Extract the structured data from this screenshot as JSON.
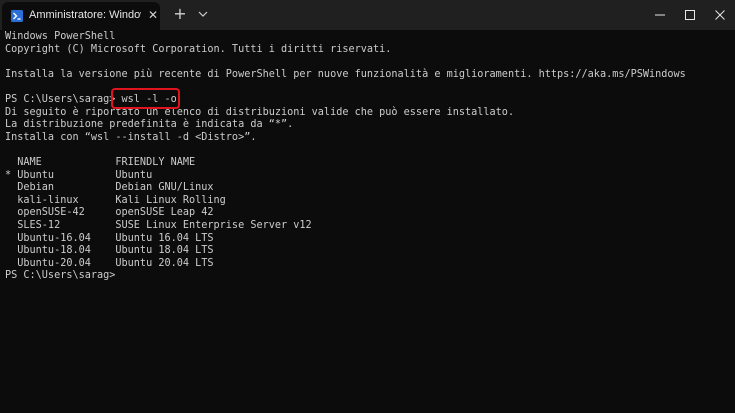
{
  "window": {
    "tab_title": "Amministratore: Windows PowerShell",
    "tab_icon": "powershell-icon",
    "new_tab_label": "+",
    "close_glyph": "✕",
    "accent_highlight": "#e0141e"
  },
  "terminal": {
    "lines": [
      "Windows PowerShell",
      "Copyright (C) Microsoft Corporation. Tutti i diritti riservati.",
      "",
      "Installa la versione più recente di PowerShell per nuove funzionalità e miglioramenti. https://aka.ms/PSWindows",
      "",
      "PS C:\\Users\\sarag> wsl -l -o",
      "Di seguito è riportato un elenco di distribuzioni valide che può essere installato.",
      "La distribuzione predefinita è indicata da “*”.",
      "Installa con “wsl --install -d <Distro>”.",
      "",
      "  NAME            FRIENDLY NAME",
      "* Ubuntu          Ubuntu",
      "  Debian          Debian GNU/Linux",
      "  kali-linux      Kali Linux Rolling",
      "  openSUSE-42     openSUSE Leap 42",
      "  SLES-12         SUSE Linux Enterprise Server v12",
      "  Ubuntu-16.04    Ubuntu 16.04 LTS",
      "  Ubuntu-18.04    Ubuntu 18.04 LTS",
      "  Ubuntu-20.04    Ubuntu 20.04 LTS",
      "PS C:\\Users\\sarag>"
    ]
  }
}
